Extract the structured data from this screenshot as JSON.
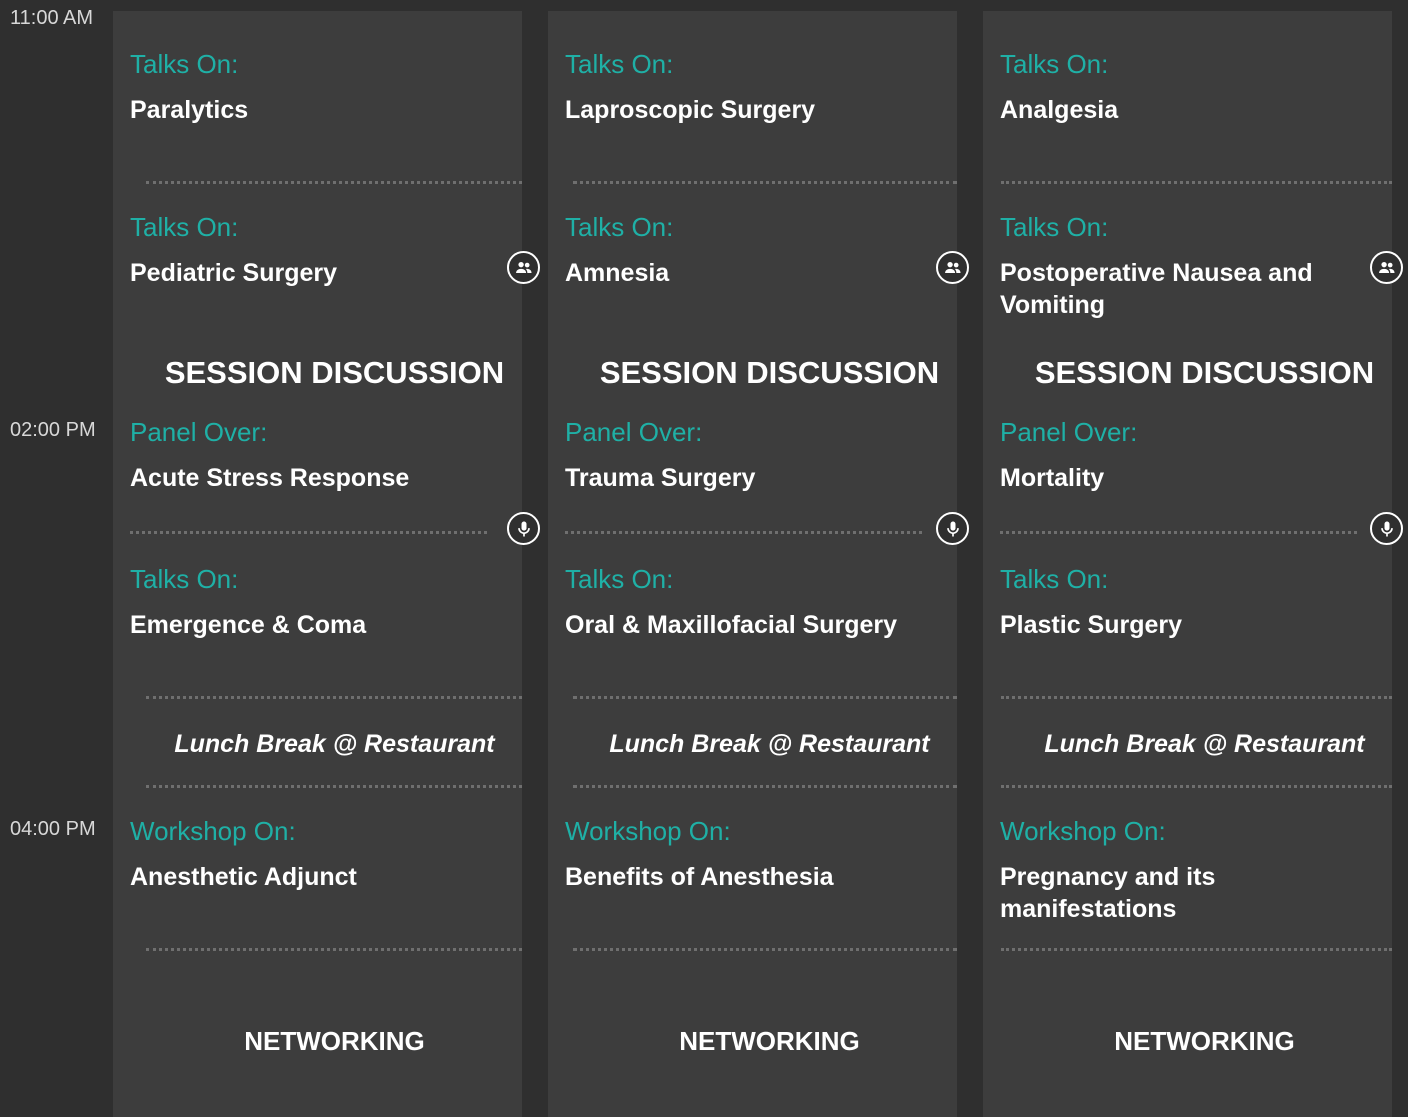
{
  "times": [
    "11:00 AM",
    "02:00 PM",
    "04:00 PM"
  ],
  "labels": {
    "talks": "Talks On:",
    "panel": "Panel Over:",
    "workshop": "Workshop On:",
    "session": "SESSION DISCUSSION",
    "lunch": "Lunch Break @ Restaurant",
    "networking": "NETWORKING"
  },
  "icons": {
    "group": "people-icon",
    "mic": "microphone-icon"
  },
  "colors": {
    "accent": "#1fb0a6",
    "background": "#2f2f2f",
    "card": "#3d3d3d",
    "text": "#ffffff"
  },
  "columns": [
    {
      "talk1": "Paralytics",
      "talk2": "Pediatric Surgery",
      "panel": "Acute Stress Response",
      "talk3": "Emergence & Coma",
      "workshop": "Anesthetic Adjunct"
    },
    {
      "talk1": "Laproscopic Surgery",
      "talk2": "Amnesia",
      "panel": "Trauma Surgery",
      "talk3": "Oral & Maxillofacial Surgery",
      "workshop": "Benefits of Anesthesia"
    },
    {
      "talk1": "Analgesia",
      "talk2": "Postoperative Nausea and Vomiting",
      "panel": "Mortality",
      "talk3": "Plastic Surgery",
      "workshop": "Pregnancy and its manifestations"
    }
  ]
}
